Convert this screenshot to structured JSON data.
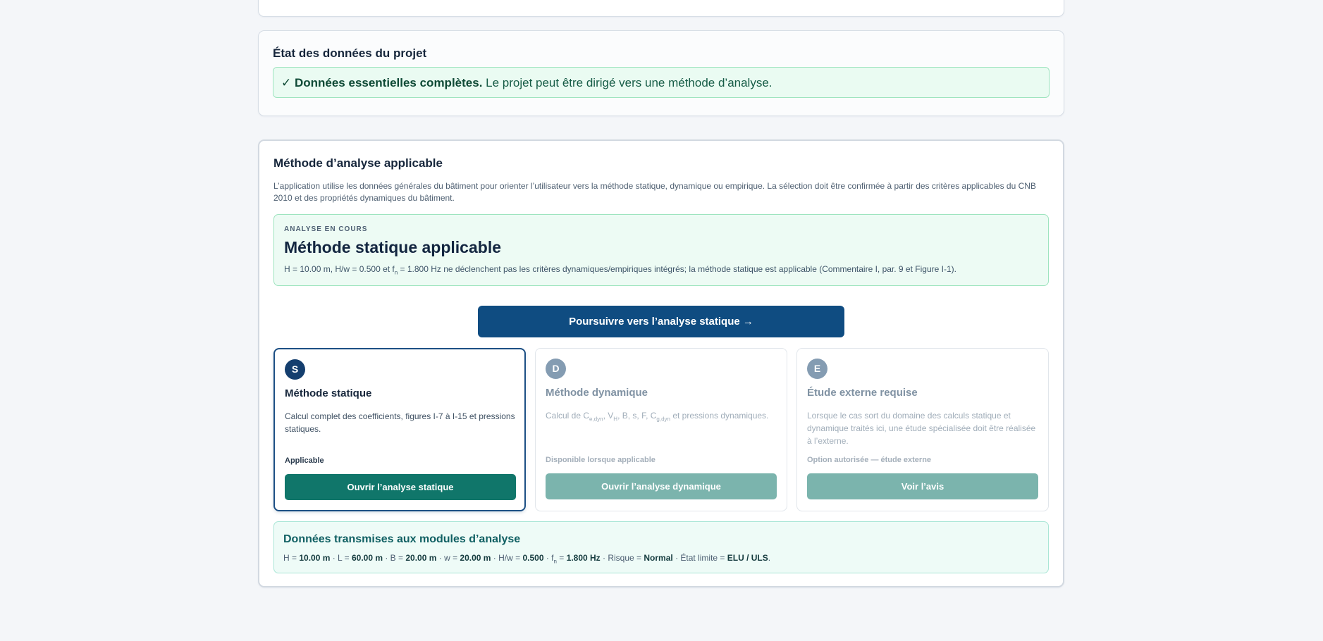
{
  "status_card": {
    "title": "État des données du projet",
    "message_bold": "✓ Données essentielles complètes.",
    "message_rest": " Le projet peut être dirigé vers une méthode d’analyse."
  },
  "method_card": {
    "title": "Méthode d’analyse applicable",
    "description": "L’application utilise les données générales du bâtiment pour orienter l’utilisateur vers la méthode statique, dynamique ou empirique. La sélection doit être confirmée à partir des critères applicables du CNB 2010 et des propriétés dynamiques du bâtiment.",
    "analysis": {
      "kicker": "ANALYSE EN COURS",
      "title": "Méthode statique applicable",
      "text_part1": "H = 10.00 m, H/w = 0.500 et f",
      "text_sub": "n",
      "text_part2": " = 1.800 Hz ne déclenchent pas les critères dynamiques/empiriques intégrés; la méthode statique est applicable (Commentaire I, par. 9 et Figure I-1)."
    },
    "proceed_label": "Poursuivre vers l’analyse statique →",
    "options": [
      {
        "badge": "S",
        "title": "Méthode statique",
        "description": "Calcul complet des coefficients, figures I-7 à I-15 et pressions statiques.",
        "status": "Applicable",
        "button": "Ouvrir l’analyse statique"
      },
      {
        "badge": "D",
        "title": "Méthode dynamique",
        "desc_p1": "Calcul de C",
        "desc_s1": "e,dyn",
        "desc_p2": ", V",
        "desc_s2": "H",
        "desc_p3": ", B, s, F, C",
        "desc_s3": "g,dyn",
        "desc_p4": " et pressions dynamiques.",
        "status": "Disponible lorsque applicable",
        "button": "Ouvrir l’analyse dynamique"
      },
      {
        "badge": "E",
        "title": "Étude externe requise",
        "description": "Lorsque le cas sort du domaine des calculs statique et dynamique traités ici, une étude spécialisée doit être réalisée à l’externe.",
        "status": "Option autorisée — étude externe",
        "button": "Voir l’avis"
      }
    ],
    "transmitted": {
      "title": "Données transmises aux modules d’analyse",
      "h_label": "H = ",
      "h_value": "10.00 m",
      "l_label": " · L = ",
      "l_value": "60.00 m",
      "b_label": " · B = ",
      "b_value": "20.00 m",
      "w_label": " · w = ",
      "w_value": "20.00 m",
      "hw_label": " · H/w = ",
      "hw_value": "0.500",
      "f_label": " · f",
      "f_sub": "n",
      "f_eq": " = ",
      "f_value": "1.800 Hz",
      "risk_label": " · Risque = ",
      "risk_value": "Normal",
      "state_label": " · État limite = ",
      "state_value": "ELU / ULS",
      "end": "."
    }
  }
}
